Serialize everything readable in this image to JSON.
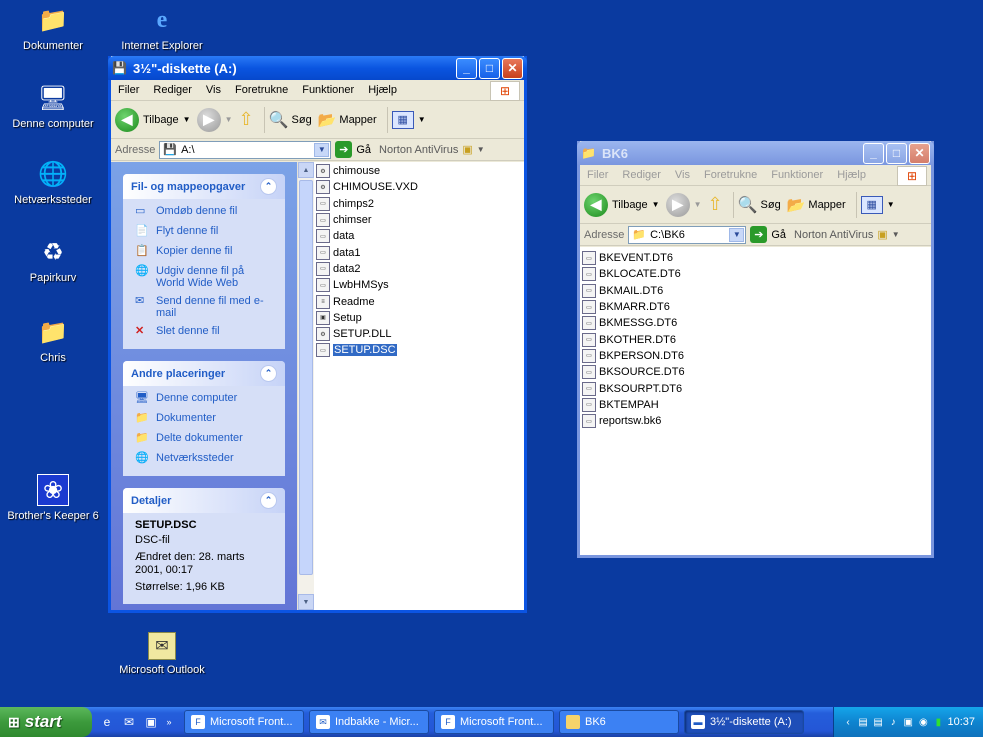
{
  "desktop": {
    "icons": [
      {
        "label": "Dokumenter",
        "icon": "folder-icon"
      },
      {
        "label": "Internet Explorer",
        "icon": "ie-icon"
      },
      {
        "label": "Denne computer",
        "icon": "computer-icon"
      },
      {
        "label": "Netværkssteder",
        "icon": "network-icon"
      },
      {
        "label": "Papirkurv",
        "icon": "recycle-bin-icon"
      },
      {
        "label": "Chris",
        "icon": "folder-icon"
      },
      {
        "label": "Brother's Keeper 6",
        "icon": "app-icon"
      },
      {
        "label": "Microsoft Outlook",
        "icon": "outlook-icon"
      }
    ]
  },
  "window1": {
    "title": "3½\"-diskette (A:)",
    "menu": [
      "Filer",
      "Rediger",
      "Vis",
      "Foretrukne",
      "Funktioner",
      "Hjælp"
    ],
    "toolbar": {
      "back": "Tilbage",
      "search": "Søg",
      "folders": "Mapper"
    },
    "address": {
      "label": "Adresse",
      "value": "A:\\",
      "go": "Gå",
      "norton": "Norton AntiVirus"
    },
    "taskpane": {
      "tasks_title": "Fil- og mappeopgaver",
      "tasks": [
        "Omdøb denne fil",
        "Flyt denne fil",
        "Kopier denne fil",
        "Udgiv denne fil på World Wide Web",
        "Send denne fil med e-mail",
        "Slet denne fil"
      ],
      "places_title": "Andre placeringer",
      "places": [
        "Denne computer",
        "Dokumenter",
        "Delte dokumenter",
        "Netværkssteder"
      ],
      "details_title": "Detaljer",
      "details": {
        "name": "SETUP.DSC",
        "type": "DSC-fil",
        "modified": "Ændret den: 28. marts 2001, 00:17",
        "size": "Størrelse: 1,96 KB"
      }
    },
    "files": [
      "chimouse",
      "CHIMOUSE.VXD",
      "chimps2",
      "chimser",
      "data",
      "data1",
      "data2",
      "LwbHMSys",
      "Readme",
      "Setup",
      "SETUP.DLL",
      "SETUP.DSC"
    ],
    "selected_file": "SETUP.DSC"
  },
  "window2": {
    "title": "BK6",
    "menu": [
      "Filer",
      "Rediger",
      "Vis",
      "Foretrukne",
      "Funktioner",
      "Hjælp"
    ],
    "toolbar": {
      "back": "Tilbage",
      "search": "Søg",
      "folders": "Mapper"
    },
    "address": {
      "label": "Adresse",
      "value": "C:\\BK6",
      "go": "Gå",
      "norton": "Norton AntiVirus"
    },
    "files": [
      "BKEVENT.DT6",
      "BKLOCATE.DT6",
      "BKMAIL.DT6",
      "BKMARR.DT6",
      "BKMESSG.DT6",
      "BKOTHER.DT6",
      "BKPERSON.DT6",
      "BKSOURCE.DT6",
      "BKSOURPT.DT6",
      "BKTEMPAH",
      "reportsw.bk6"
    ]
  },
  "taskbar": {
    "start": "start",
    "tasks": [
      "Microsoft Front...",
      "Indbakke - Micr...",
      "Microsoft Front...",
      "BK6",
      "3½\"-diskette (A:)"
    ],
    "active_task": 4,
    "clock": "10:37"
  }
}
